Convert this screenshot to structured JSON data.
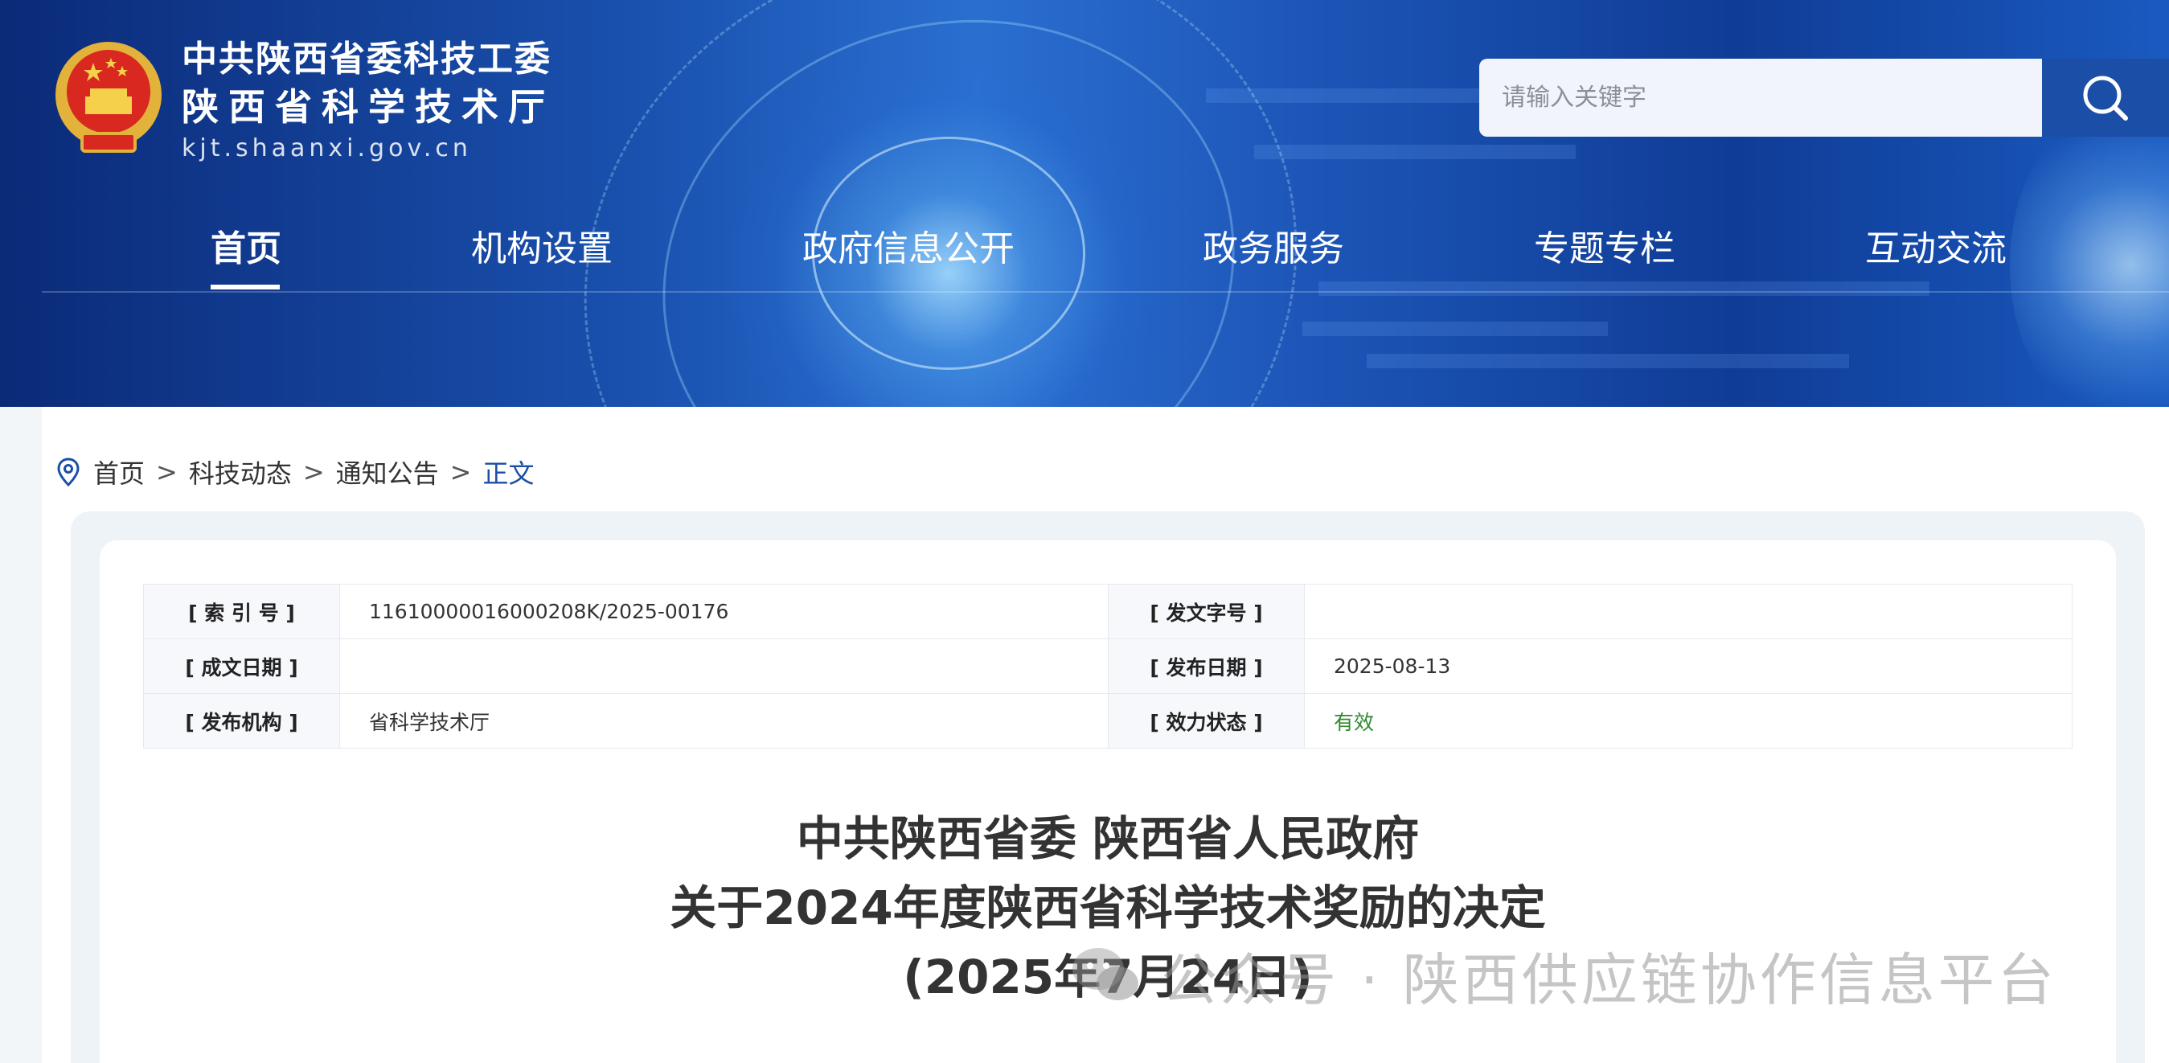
{
  "header": {
    "site_title_line1": "中共陕西省委科技工委",
    "site_title_line2": "陕西省科学技术厅",
    "site_domain": "kjt.shaanxi.gov.cn",
    "emblem_icon": "national-emblem-icon"
  },
  "search": {
    "placeholder": "请输入关键字",
    "button_icon": "search-icon"
  },
  "nav": {
    "items": [
      {
        "label": "首页",
        "active": true
      },
      {
        "label": "机构设置",
        "active": false
      },
      {
        "label": "政府信息公开",
        "active": false
      },
      {
        "label": "政务服务",
        "active": false
      },
      {
        "label": "专题专栏",
        "active": false
      },
      {
        "label": "互动交流",
        "active": false
      }
    ]
  },
  "breadcrumb": {
    "icon": "location-pin-icon",
    "items": [
      "首页",
      "科技动态",
      "通知公告"
    ],
    "separator": ">",
    "current": "正文"
  },
  "meta": {
    "index_no_label": "[ 索 引 号 ]",
    "index_no_value": "11610000016000208K/2025-00176",
    "doc_no_label": "[ 发文字号 ]",
    "doc_no_value": "",
    "written_date_label": "[ 成文日期 ]",
    "written_date_value": "",
    "publish_date_label": "[ 发布日期 ]",
    "publish_date_value": "2025-08-13",
    "publisher_label": "[ 发布机构 ]",
    "publisher_value": "省科学技术厅",
    "status_label": "[ 效力状态 ]",
    "status_value": "有效"
  },
  "document": {
    "title_line1": "中共陕西省委 陕西省人民政府",
    "title_line2": "关于2024年度陕西省科学技术奖励的决定",
    "title_line3": "(2025年7月24日)"
  },
  "watermark": {
    "text": "公众号 · 陕西供应链协作信息平台",
    "icon": "wechat-icon"
  },
  "colors": {
    "brand_blue": "#1b4ea6",
    "valid_green": "#2f8a2f"
  }
}
